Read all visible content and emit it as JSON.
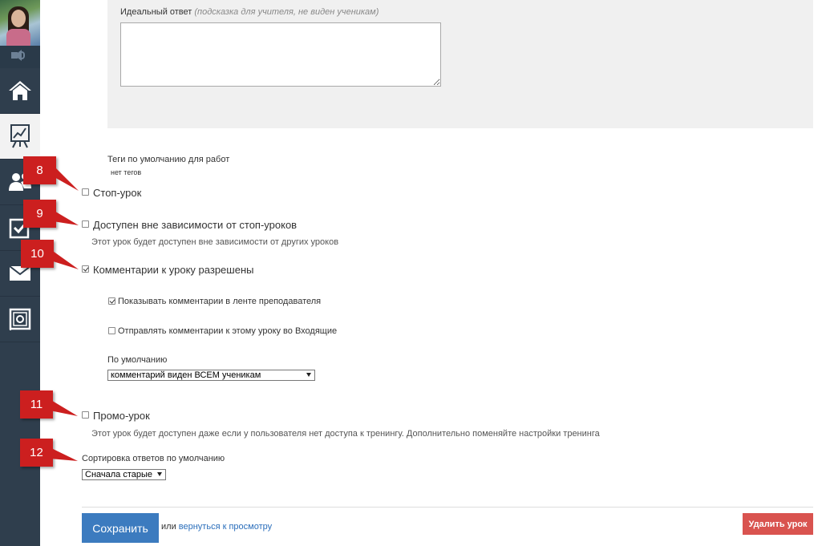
{
  "panel": {
    "ideal_answer_label": "Идеальный ответ",
    "ideal_answer_hint": "(подсказка для учителя, не виден ученикам)",
    "ideal_answer_value": ""
  },
  "tags": {
    "label": "Теги по умолчанию для работ",
    "value": "нет тегов"
  },
  "options": {
    "stop_lesson": {
      "label": "Стоп-урок",
      "checked": false
    },
    "available_regardless": {
      "label": "Доступен вне зависимости от стоп-уроков",
      "description": "Этот урок будет доступен вне зависимости от других уроков",
      "checked": false
    },
    "comments_allowed": {
      "label": "Комментарии к уроку разрешены",
      "checked": true
    },
    "show_in_teacher_feed": {
      "label": "Показывать комментарии в ленте преподавателя",
      "checked": true
    },
    "send_to_inbox": {
      "label": "Отправлять комментарии к этому уроку во Входящие",
      "checked": false
    },
    "default_label": "По умолчанию",
    "default_visibility": "комментарий виден ВСЕМ ученикам",
    "promo_lesson": {
      "label": "Промо-урок",
      "description": "Этот урок будет доступен даже если у пользователя нет доступа к тренингу. Дополнительно поменяйте настройки тренинга",
      "checked": false
    },
    "sort_label": "Сортировка ответов по умолчанию",
    "sort_value": "Сначала старые"
  },
  "footer": {
    "save_label": "Сохранить",
    "or_text": "или",
    "back_link": "вернуться к просмотру",
    "delete_label": "Удалить урок"
  },
  "callouts": [
    "8",
    "9",
    "10",
    "11",
    "12"
  ],
  "colors": {
    "sidebar": "#2f3e4d",
    "callout": "#cc1f1f",
    "save_button": "#3c7bbf",
    "delete_button": "#d9534f",
    "link": "#2a6ebb"
  },
  "sidebar_icons": [
    "volume-icon",
    "home-icon",
    "chart-board-icon",
    "users-icon",
    "checkbox-icon",
    "mail-icon",
    "safe-icon"
  ]
}
